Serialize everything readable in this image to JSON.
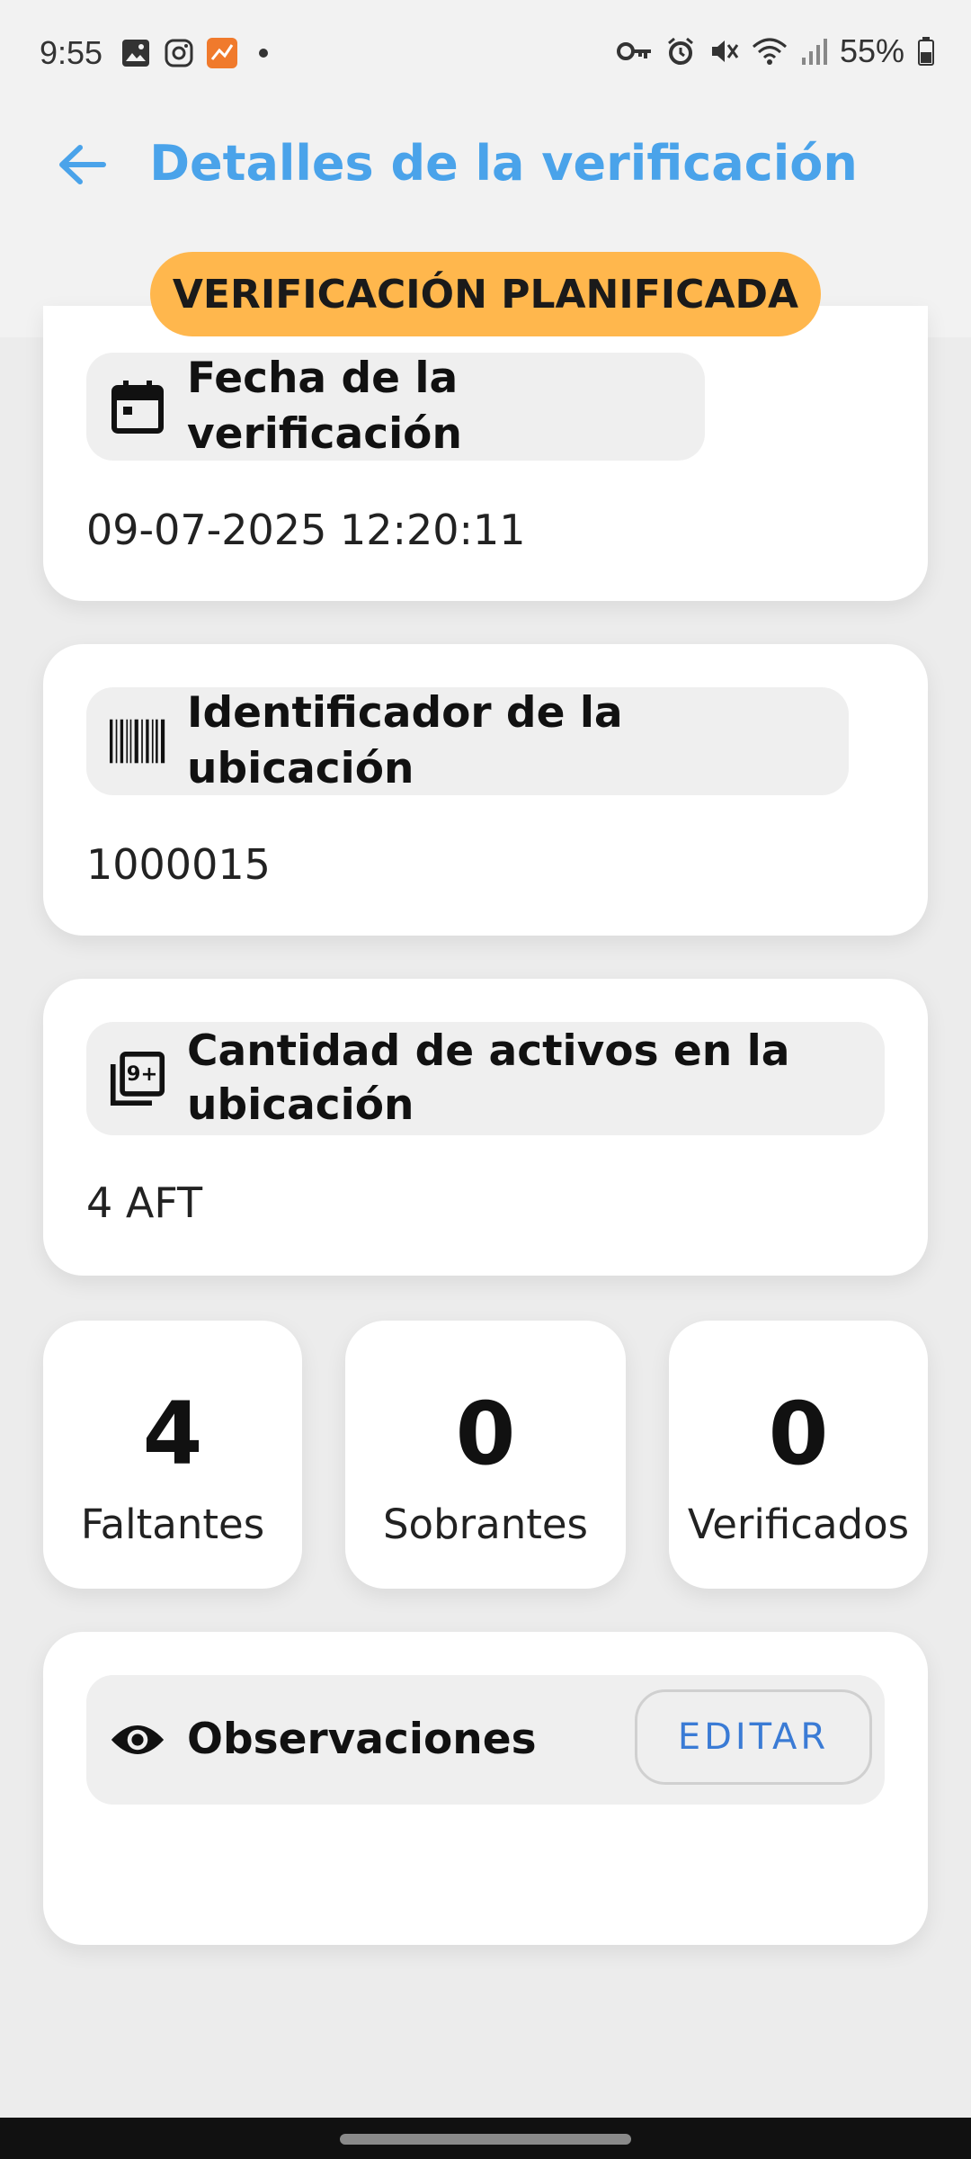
{
  "status_bar": {
    "time": "9:55",
    "battery": "55%",
    "left_icons": [
      "gallery-icon",
      "instagram-icon",
      "app-notification-icon"
    ],
    "right_icons": [
      "key-icon",
      "alarm-icon",
      "mute-icon",
      "wifi-icon",
      "signal-icon",
      "battery-icon"
    ]
  },
  "header": {
    "title": "Detalles de la verificación",
    "back_icon": "arrow-left-icon",
    "accent_color": "#4aa3ea"
  },
  "status_badge": {
    "label": "VERIFICACIÓN PLANIFICADA",
    "color": "#ffb74d"
  },
  "cards": {
    "date": {
      "icon": "calendar-icon",
      "label": "Fecha de la verificación",
      "value": "09-07-2025 12:20:11"
    },
    "location": {
      "icon": "barcode-icon",
      "label": "Identificador de la ubicación",
      "value": "1000015"
    },
    "assets": {
      "icon": "filter-9-plus-icon",
      "label_line1": "Cantidad de activos en la",
      "label_line2": "ubicación",
      "value": "4 AFT"
    }
  },
  "stats": [
    {
      "value": "4",
      "label": "Faltantes"
    },
    {
      "value": "0",
      "label": "Sobrantes"
    },
    {
      "value": "0",
      "label": "Verificados"
    }
  ],
  "observations": {
    "icon": "eye-icon",
    "label": "Observaciones",
    "edit_label": "EDITAR"
  }
}
